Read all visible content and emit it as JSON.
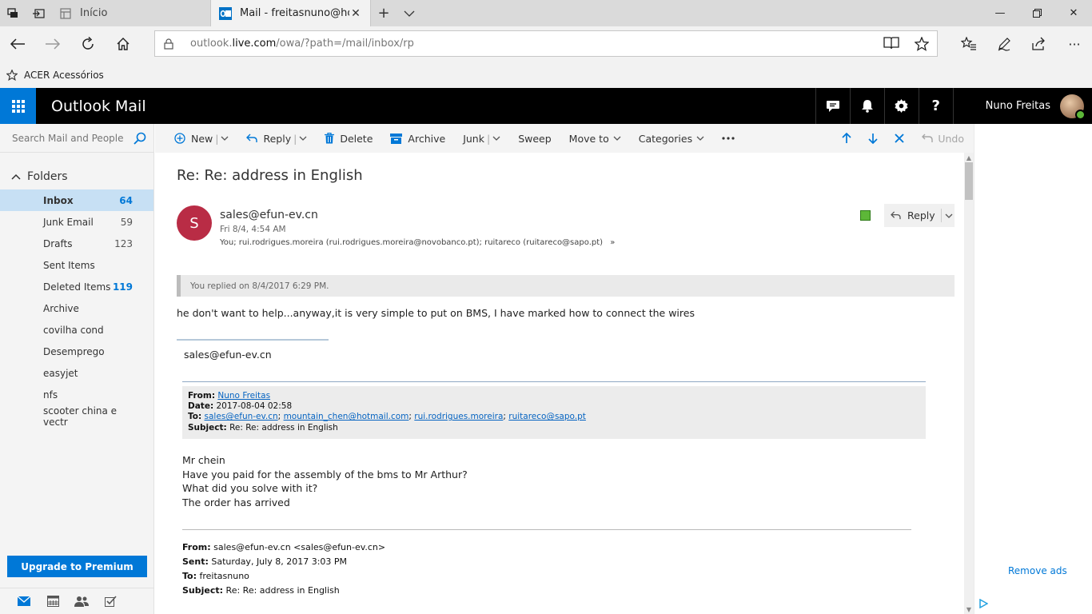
{
  "browser": {
    "tabs": [
      {
        "title": "Início",
        "active": false
      },
      {
        "title": "Mail - freitasnuno@hotmail.com",
        "active": true
      }
    ],
    "url": {
      "prefix": "outlook.",
      "domain": "live.com",
      "path": "/owa/?path=/mail/inbox/rp"
    },
    "favorites": [
      {
        "label": "ACER Acessórios"
      }
    ]
  },
  "app": {
    "title": "Outlook Mail",
    "user_name": "Nuno Freitas"
  },
  "sidebar": {
    "search_placeholder": "Search Mail and People",
    "folders_label": "Folders",
    "items": [
      {
        "name": "Inbox",
        "count": "64",
        "selected": true
      },
      {
        "name": "Junk Email",
        "count": "59"
      },
      {
        "name": "Drafts",
        "count": "123"
      },
      {
        "name": "Sent Items",
        "count": ""
      },
      {
        "name": "Deleted Items",
        "count": "119"
      },
      {
        "name": "Archive",
        "count": ""
      },
      {
        "name": "covilha cond",
        "count": ""
      },
      {
        "name": "Desemprego",
        "count": ""
      },
      {
        "name": "easyjet",
        "count": ""
      },
      {
        "name": "nfs",
        "count": ""
      },
      {
        "name": "scooter china e vectr",
        "count": ""
      }
    ],
    "upgrade_label": "Upgrade to Premium"
  },
  "toolbar": {
    "new": "New",
    "reply": "Reply",
    "delete": "Delete",
    "archive": "Archive",
    "junk": "Junk",
    "sweep": "Sweep",
    "move_to": "Move to",
    "categories": "Categories",
    "undo": "Undo"
  },
  "message": {
    "subject": "Re: Re: address in English",
    "sender_initial": "S",
    "sender": "sales@efun-ev.cn",
    "date": "Fri 8/4, 4:54 AM",
    "recipients": "You; rui.rodrigues.moreira (rui.rodrigues.moreira@novobanco.pt); ruitareco (ruitareco@sapo.pt)",
    "reply_label": "Reply",
    "replied_note": "You replied on 8/4/2017 6:29 PM.",
    "body": "he don't want to help...anyway,it is very simple to put on BMS, I have marked how to connect the wires",
    "signature": "sales@efun-ev.cn",
    "quote_header": {
      "from_label": "From:",
      "from": "Nuno Freitas",
      "date_label": "Date:",
      "date": "2017-08-04 02:58",
      "to_label": "To:",
      "to": [
        "sales@efun-ev.cn",
        "mountain_chen@hotmail.com",
        "rui.rodrigues.moreira",
        "ruitareco@sapo.pt"
      ],
      "subject_label": "Subject:",
      "subject": "Re: Re: address in English"
    },
    "quoted_body": [
      "Mr chein",
      "Have you paid for the assembly of the bms to Mr Arthur?",
      "What did you solve with it?",
      "The order has arrived"
    ],
    "original_header": {
      "from_label": "From:",
      "from": "sales@efun-ev.cn <sales@efun-ev.cn>",
      "sent_label": "Sent:",
      "sent": "Saturday, July 8, 2017 3:03 PM",
      "to_label": "To:",
      "to": "freitasnuno",
      "subject_label": "Subject:",
      "subject": "Re: Re: address in English"
    }
  },
  "ads": {
    "remove_ads": "Remove ads"
  },
  "colors": {
    "accent": "#0078d7",
    "header_bg": "#000000",
    "avatar_bg": "#b92c45"
  }
}
